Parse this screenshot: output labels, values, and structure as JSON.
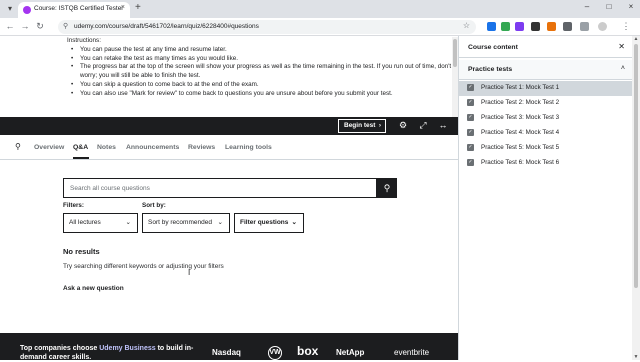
{
  "browser": {
    "tab_title": "Course: ISTQB Certified Tester",
    "tab_close": "×",
    "new_tab": "+",
    "url": "udemy.com/course/draft/5461702/learn/quiz/6228400#questions",
    "window_controls": {
      "minimize": "–",
      "maximize": "□",
      "close": "×"
    }
  },
  "instructions": {
    "heading": "Instructions:",
    "items": [
      "You can pause the test at any time and resume later.",
      "You can retake the test as many times as you would like.",
      "The progress bar at the top of the screen will show your progress as well as the time remaining in the test. If you run out of time, don't worry; you will still be able to finish the test.",
      "You can skip a question to come back to at the end of the exam.",
      "You can also use \"Mark for review\" to come back to questions you are unsure about before you submit your test."
    ]
  },
  "controls": {
    "begin_label": "Begin test",
    "begin_chevron": "›"
  },
  "course_tabs": {
    "items": [
      "Overview",
      "Q&A",
      "Notes",
      "Announcements",
      "Reviews",
      "Learning tools"
    ],
    "active": "Q&A"
  },
  "qa": {
    "search_placeholder": "Search all course questions",
    "filters_label": "Filters:",
    "sort_label": "Sort by:",
    "filter_dropdown": "All lectures",
    "sort_dropdown": "Sort by recommended",
    "filter_questions": "Filter questions",
    "no_results": "No results",
    "try_text": "Try searching different keywords or adjusting your filters",
    "ask_new": "Ask a new question"
  },
  "footer": {
    "text_pre": "Top companies choose ",
    "brand": "Udemy Business",
    "text_post": " to build in-demand career skills.",
    "logos": [
      "Nasdaq",
      "VW",
      "box",
      "NetApp",
      "eventbrite"
    ]
  },
  "sidebar": {
    "title": "Course content",
    "section": "Practice tests",
    "lectures": [
      "Practice Test 1: Mock Test 1",
      "Practice Test 2: Mock Test 2",
      "Practice Test 3: Mock Test 3",
      "Practice Test 4: Mock Test 4",
      "Practice Test 5: Mock Test 5",
      "Practice Test 6: Mock Test 6"
    ],
    "active_index": 0
  },
  "colors": {
    "brand_purple": "#a435f0",
    "dark": "#1c1d1f",
    "footer_brand": "#c0c4fc"
  }
}
